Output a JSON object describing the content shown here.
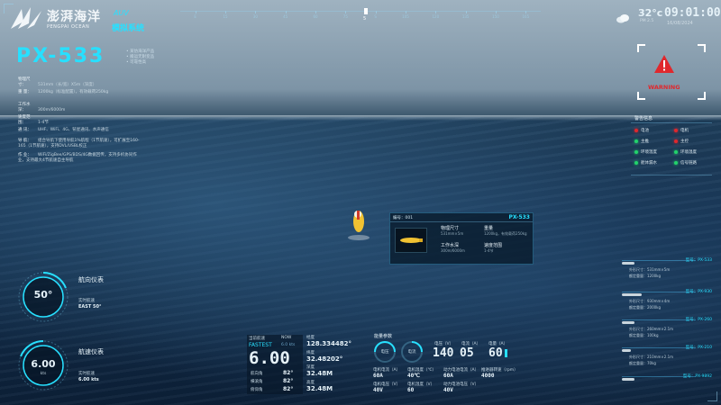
{
  "brand": {
    "name_cn": "澎湃海洋",
    "name_en": "PENGPAI OCEAN",
    "product": "AUV",
    "system": "模拟系统"
  },
  "scale": {
    "labels": [
      "E",
      "15",
      "30",
      "45",
      "60",
      "75",
      "S",
      "105",
      "120",
      "135",
      "150",
      "165"
    ],
    "marker": "5"
  },
  "weather": {
    "temp": "32°c",
    "pm": "PM 2.5",
    "time": "09:01:00",
    "date": "16/08/2024"
  },
  "warning": {
    "label": "WARNING",
    "color": "#e0282d"
  },
  "vessel": {
    "name": "PX-533",
    "tags": [
      "• 某仿海洋产品",
      "• 搬运无耐变品",
      "• 可靠性高"
    ],
    "specs": [
      {
        "k": "物理尺寸：",
        "v": "531mm（长/宽）X5m（深度）"
      },
      {
        "k": "重  量：",
        "v": "1200kg（标准配置），有效载荷250kg"
      },
      {
        "k": "工作水深：",
        "v": "300m/6000m"
      },
      {
        "k": "速度范围：",
        "v": "1-4节"
      },
      {
        "k": "通  讯：",
        "v": "UHF、WiFi、4G、铱星通讯、水声通信"
      },
      {
        "k": "导  航：",
        "v": "组合导航下使用导航1%航程（1节航速），可扩展至160-165（1节航速），支持DVL/USBL校正"
      },
      {
        "k": "作  业：",
        "v": "WiFi/ZigBee/GPS/BDS/4G数据回传，支持多机协同作业，支持最大4节航速自主导航"
      }
    ]
  },
  "alerts": {
    "title": "警告信息",
    "items": [
      {
        "label": "电池",
        "color": "#e0282d"
      },
      {
        "label": "电机",
        "color": "#e0282d"
      },
      {
        "label": "主推",
        "color": "#22d36b"
      },
      {
        "label": "主控",
        "color": "#e0282d"
      },
      {
        "label": "环境温度",
        "color": "#22d36b"
      },
      {
        "label": "环境湿度",
        "color": "#22d36b"
      },
      {
        "label": "舱体漏水",
        "color": "#22d36b"
      },
      {
        "label": "信号链路",
        "color": "#22d36b"
      }
    ]
  },
  "popup": {
    "id": "编号：001",
    "model": "PX-533",
    "fields": [
      {
        "k": "物理尺寸",
        "v": "531mm×5m"
      },
      {
        "k": "重量",
        "v": "1200kg，有效载荷250kg"
      },
      {
        "k": "工作水深",
        "v": "300m/6000m"
      },
      {
        "k": "速度范围",
        "v": "1-4节"
      }
    ]
  },
  "fleet": [
    {
      "title": "型号：PX-533",
      "l1": "外形尺寸：531mm×5m",
      "l2": "额定重量：1200kg"
    },
    {
      "title": "型号：PX-930",
      "l1": "外形尺寸：930mm×4m",
      "l2": "额定重量：2000kg"
    },
    {
      "title": "型号：PX-260",
      "l1": "外形尺寸：260mm×2.1m",
      "l2": "额定重量：100kg"
    },
    {
      "title": "型号：PX-210",
      "l1": "外形尺寸：210mm×2.1m",
      "l2": "额定重量：70kg"
    },
    {
      "title": "型号：PX-9892",
      "l1": "",
      "l2": ""
    }
  ],
  "heading": {
    "title": "航向仪表",
    "value": "50°",
    "sub_label": "实时航速",
    "sub_value": "EAST 50°"
  },
  "speed": {
    "title": "航速仪表",
    "value": "6.00",
    "unit": "kts",
    "sub_label": "实时航速",
    "sub_value": "6.00 kts"
  },
  "nav": {
    "mode_label": "当前航速",
    "now": "NOW",
    "mode": "FASTEST",
    "mode_unit": "6.0 kts",
    "value": "6.00",
    "rows": [
      {
        "k": "航向角",
        "v": "82°"
      },
      {
        "k": "横滚角",
        "v": "82°"
      },
      {
        "k": "俯仰角",
        "v": "82°"
      }
    ],
    "lng_label": "经度",
    "lng": "128.334482°",
    "lat_label": "纬度",
    "lat": "32.48202°",
    "depth_label": "深度",
    "depth": "32.48M",
    "alt_label": "高度",
    "alt": "32.48M"
  },
  "power": {
    "title": "能量参数",
    "g1": "电压",
    "g2": "电流",
    "volt_label": "电压（V）",
    "volt": "140",
    "curr_label": "电流（A）",
    "curr": "05",
    "cap_label": "电量（A）",
    "cap": "60",
    "bottom": [
      {
        "k": "电机电流（A）",
        "v": "60A"
      },
      {
        "k": "电机温度（℃）",
        "v": "40℃"
      },
      {
        "k": "动力电池电流（A）",
        "v": "60A"
      },
      {
        "k": "推进器转速（rpm）",
        "v": "4000"
      },
      {
        "k": "电机电压（V）",
        "v": "40V"
      },
      {
        "k": "电机温度（V）",
        "v": "60"
      },
      {
        "k": "动力电池电压（V）",
        "v": "40V"
      }
    ]
  }
}
